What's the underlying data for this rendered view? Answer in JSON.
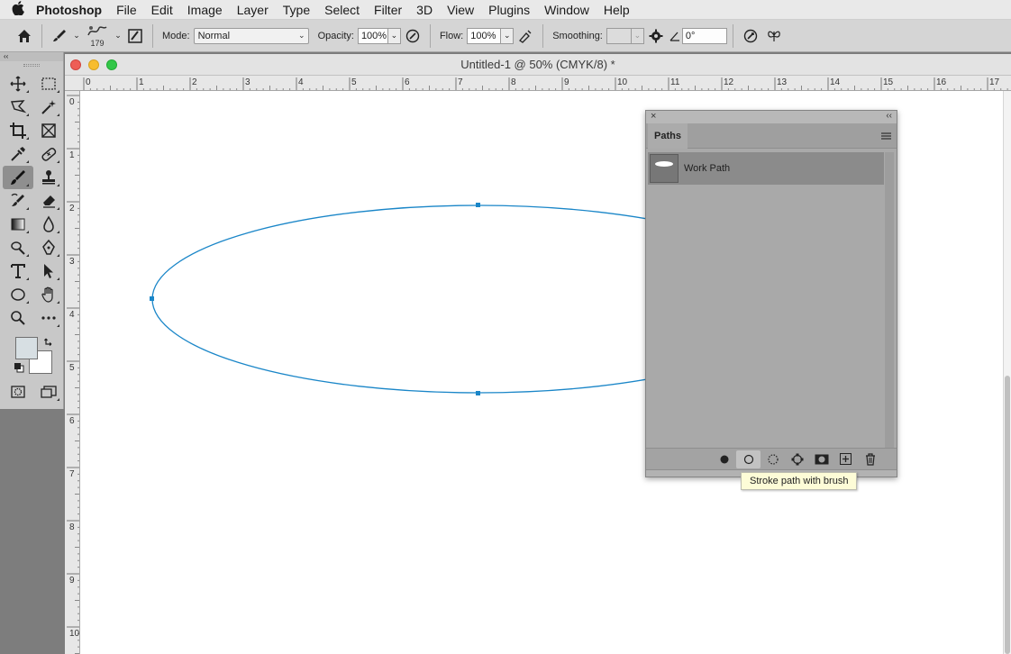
{
  "menubar": {
    "apple": "",
    "app_name": "Photoshop",
    "items": [
      "File",
      "Edit",
      "Image",
      "Layer",
      "Type",
      "Select",
      "Filter",
      "3D",
      "View",
      "Plugins",
      "Window",
      "Help"
    ]
  },
  "options_bar": {
    "brush_size": "179",
    "mode_label": "Mode:",
    "mode_value": "Normal",
    "opacity_label": "Opacity:",
    "opacity_value": "100%",
    "flow_label": "Flow:",
    "flow_value": "100%",
    "smoothing_label": "Smoothing:",
    "smoothing_value": "",
    "angle_value": "0°"
  },
  "tools_panel": {
    "collapse_glyph": "‹‹",
    "active_tool": "brush-tool",
    "foreground_color": "#d7dfe3",
    "background_color": "#ffffff"
  },
  "document": {
    "title": "Untitled-1 @ 50% (CMYK/8) *",
    "h_ruler_labels": [
      "0",
      "1",
      "2",
      "3",
      "4",
      "5",
      "6",
      "7",
      "8",
      "9",
      "10",
      "11",
      "12",
      "13",
      "14",
      "15",
      "16",
      "17"
    ],
    "v_ruler_labels": [
      "0",
      "1",
      "2",
      "3",
      "4",
      "5",
      "6",
      "7",
      "8",
      "9",
      "10"
    ],
    "path_color": "#1a86c8"
  },
  "paths_panel": {
    "tab_label": "Paths",
    "items": [
      {
        "name": "Work Path"
      }
    ],
    "footer_buttons": [
      "fill-path",
      "stroke-path",
      "load-selection",
      "make-work-path",
      "add-mask",
      "new-path",
      "delete-path"
    ]
  },
  "tooltip": {
    "text": "Stroke path with brush"
  }
}
